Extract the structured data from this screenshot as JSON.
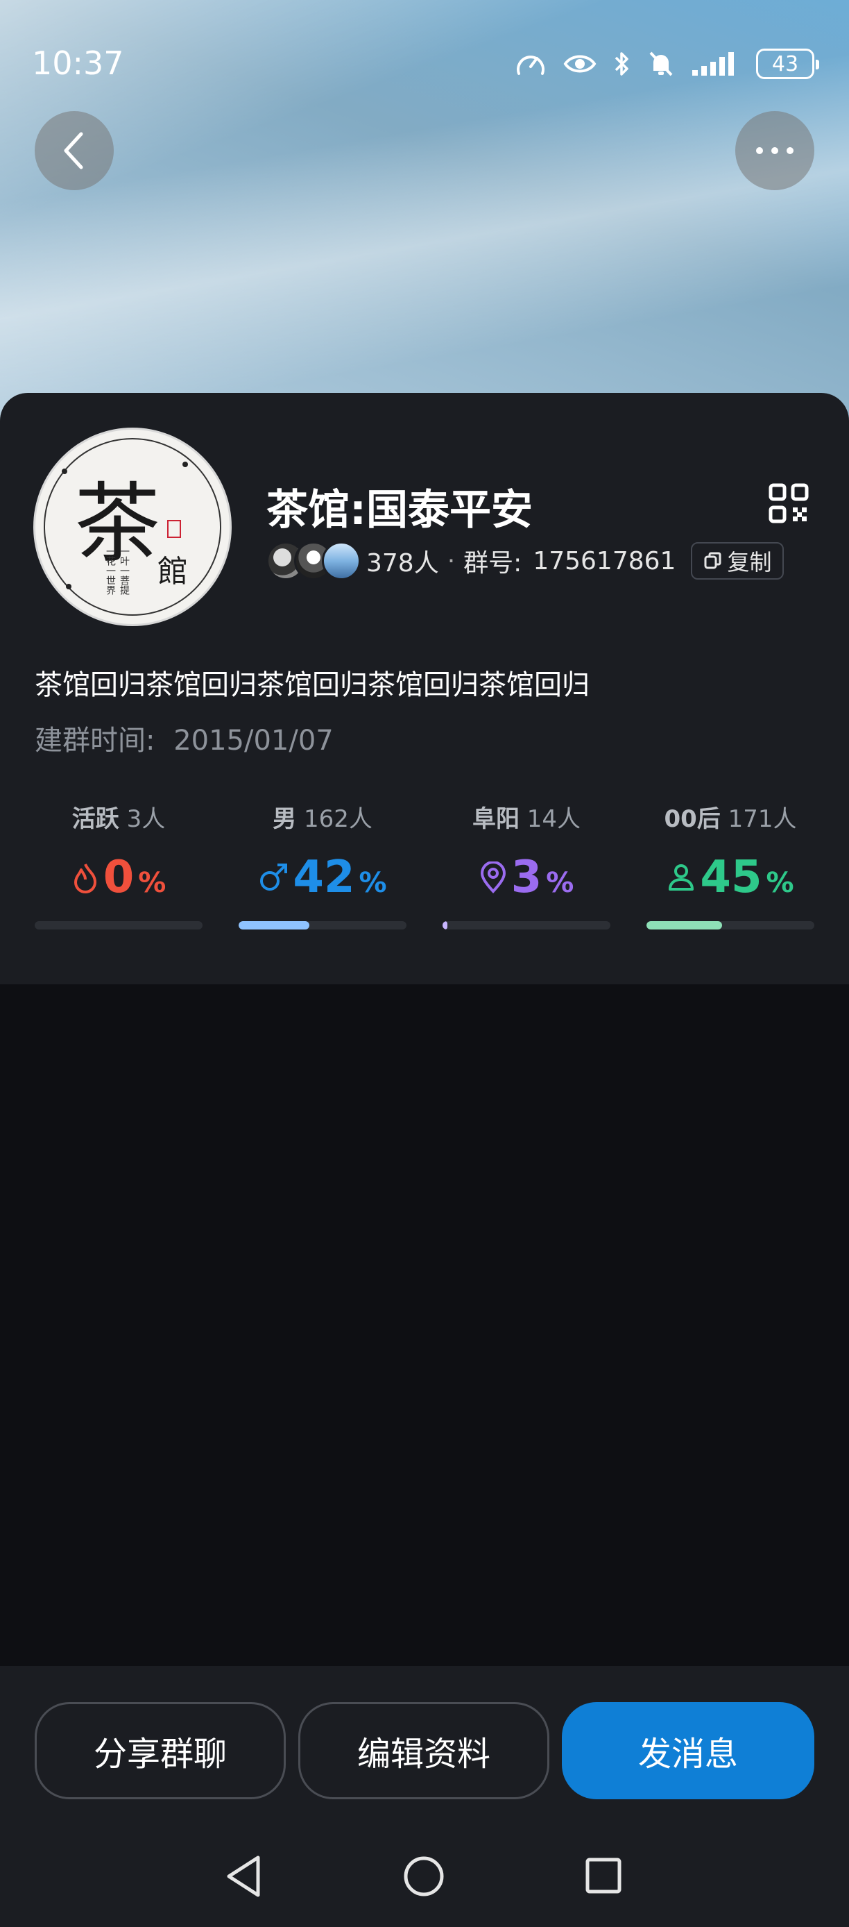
{
  "status_bar": {
    "time": "10:37",
    "battery": "43"
  },
  "group": {
    "name": "茶馆:国泰平安",
    "avatar_big_char": "茶",
    "avatar_small_char": "館",
    "avatar_vertical_1": "一花一世界",
    "avatar_vertical_2": "一叶一菩提",
    "member_count": "378人",
    "separator": "·",
    "group_number_label": "群号:",
    "group_number": "175617861",
    "copy_label": "复制",
    "description": "茶馆回归茶馆回归茶馆回归茶馆回归茶馆回归",
    "created_label": "建群时间:",
    "created_date": "2015/01/07"
  },
  "stats": [
    {
      "label": "活跃",
      "count": "3人",
      "value": "0",
      "unit": "%",
      "percent": 0,
      "color": "#f0503c",
      "icon": "fire-icon"
    },
    {
      "label": "男",
      "count": "162人",
      "value": "42",
      "unit": "%",
      "percent": 42,
      "color": "#1e8ee8",
      "icon": "male-icon"
    },
    {
      "label": "阜阳",
      "count": "14人",
      "value": "3",
      "unit": "%",
      "percent": 3,
      "color": "#9b6cf0",
      "icon": "location-icon"
    },
    {
      "label": "00后",
      "count": "171人",
      "value": "45",
      "unit": "%",
      "percent": 45,
      "color": "#2ec98a",
      "icon": "person-icon"
    }
  ],
  "bar_colors": [
    "#4a4d54",
    "#8fc3ff",
    "#c9b6ff",
    "#8ee0b7"
  ],
  "actions": {
    "share": "分享群聊",
    "edit": "编辑资料",
    "send": "发消息"
  },
  "icons": {
    "back": "chevron-left-icon",
    "more": "more-dots-icon",
    "qr": "qr-code-icon",
    "copy": "copy-icon",
    "nav_back": "triangle-back-icon",
    "nav_home": "circle-home-icon",
    "nav_recent": "square-recent-icon"
  }
}
